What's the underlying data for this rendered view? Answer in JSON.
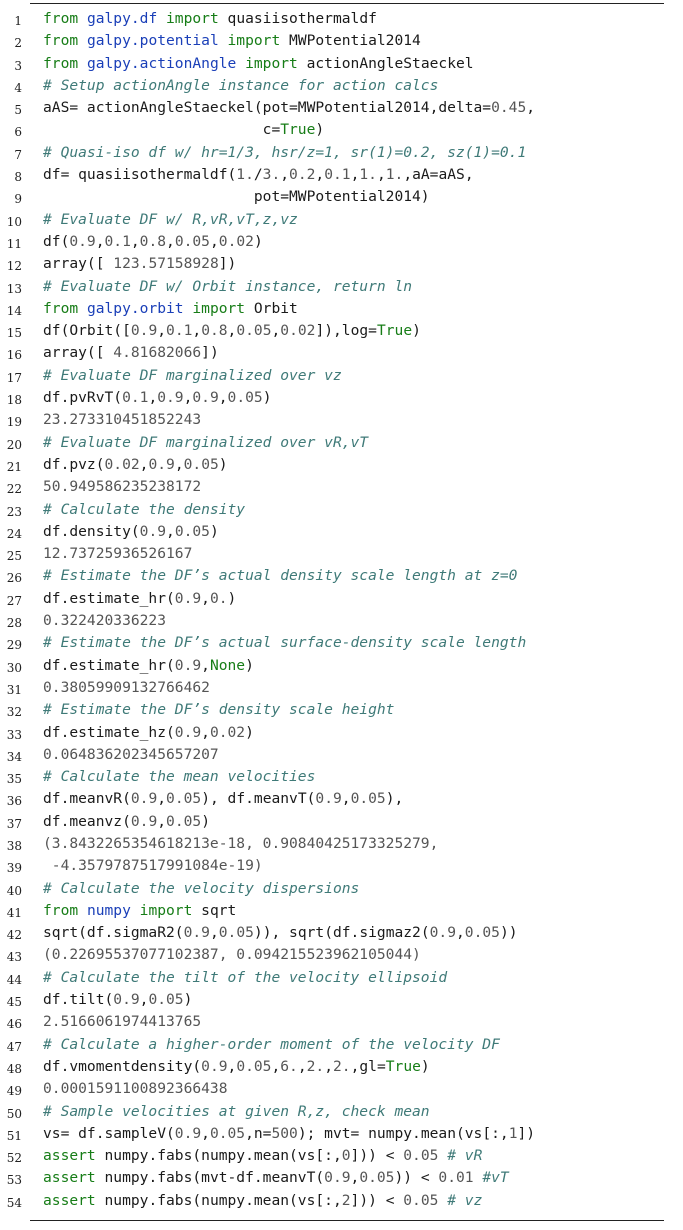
{
  "lines": [
    {
      "n": "1",
      "tokens": [
        {
          "t": "from ",
          "c": "kw"
        },
        {
          "t": "galpy.df",
          "c": "mod"
        },
        {
          "t": " import ",
          "c": "kw"
        },
        {
          "t": "quasiisothermaldf",
          "c": ""
        }
      ]
    },
    {
      "n": "2",
      "tokens": [
        {
          "t": "from ",
          "c": "kw"
        },
        {
          "t": "galpy.potential",
          "c": "mod"
        },
        {
          "t": " import ",
          "c": "kw"
        },
        {
          "t": "MWPotential2014",
          "c": ""
        }
      ]
    },
    {
      "n": "3",
      "tokens": [
        {
          "t": "from ",
          "c": "kw"
        },
        {
          "t": "galpy.actionAngle",
          "c": "mod"
        },
        {
          "t": " import ",
          "c": "kw"
        },
        {
          "t": "actionAngleStaeckel",
          "c": ""
        }
      ]
    },
    {
      "n": "4",
      "tokens": [
        {
          "t": "# Setup actionAngle instance for action calcs",
          "c": "cm"
        }
      ]
    },
    {
      "n": "5",
      "tokens": [
        {
          "t": "aAS= actionAngleStaeckel(pot=MWPotential2014,delta=",
          "c": ""
        },
        {
          "t": "0.45",
          "c": "num"
        },
        {
          "t": ",",
          "c": ""
        }
      ]
    },
    {
      "n": "6",
      "tokens": [
        {
          "t": "                         c=",
          "c": ""
        },
        {
          "t": "True",
          "c": "kw"
        },
        {
          "t": ")",
          "c": ""
        }
      ]
    },
    {
      "n": "7",
      "tokens": [
        {
          "t": "# Quasi-iso df w/ hr=1/3, hsr/z=1, sr(1)=0.2, sz(1)=0.1",
          "c": "cm"
        }
      ]
    },
    {
      "n": "8",
      "tokens": [
        {
          "t": "df= quasiisothermaldf(",
          "c": ""
        },
        {
          "t": "1.",
          "c": "num"
        },
        {
          "t": "/",
          "c": ""
        },
        {
          "t": "3.",
          "c": "num"
        },
        {
          "t": ",",
          "c": ""
        },
        {
          "t": "0.2",
          "c": "num"
        },
        {
          "t": ",",
          "c": ""
        },
        {
          "t": "0.1",
          "c": "num"
        },
        {
          "t": ",",
          "c": ""
        },
        {
          "t": "1.",
          "c": "num"
        },
        {
          "t": ",",
          "c": ""
        },
        {
          "t": "1.",
          "c": "num"
        },
        {
          "t": ",aA=aAS,",
          "c": ""
        }
      ]
    },
    {
      "n": "9",
      "tokens": [
        {
          "t": "                        pot=MWPotential2014)",
          "c": ""
        }
      ]
    },
    {
      "n": "10",
      "tokens": [
        {
          "t": "# Evaluate DF w/ R,vR,vT,z,vz",
          "c": "cm"
        }
      ]
    },
    {
      "n": "11",
      "tokens": [
        {
          "t": "df(",
          "c": ""
        },
        {
          "t": "0.9",
          "c": "num"
        },
        {
          "t": ",",
          "c": ""
        },
        {
          "t": "0.1",
          "c": "num"
        },
        {
          "t": ",",
          "c": ""
        },
        {
          "t": "0.8",
          "c": "num"
        },
        {
          "t": ",",
          "c": ""
        },
        {
          "t": "0.05",
          "c": "num"
        },
        {
          "t": ",",
          "c": ""
        },
        {
          "t": "0.02",
          "c": "num"
        },
        {
          "t": ")",
          "c": ""
        }
      ]
    },
    {
      "n": "12",
      "tokens": [
        {
          "t": "array([ ",
          "c": ""
        },
        {
          "t": "123.57158928",
          "c": "num"
        },
        {
          "t": "])",
          "c": ""
        }
      ]
    },
    {
      "n": "13",
      "tokens": [
        {
          "t": "# Evaluate DF w/ Orbit instance, return ln",
          "c": "cm"
        }
      ]
    },
    {
      "n": "14",
      "tokens": [
        {
          "t": "from ",
          "c": "kw"
        },
        {
          "t": "galpy.orbit",
          "c": "mod"
        },
        {
          "t": " import ",
          "c": "kw"
        },
        {
          "t": "Orbit",
          "c": ""
        }
      ]
    },
    {
      "n": "15",
      "tokens": [
        {
          "t": "df(Orbit([",
          "c": ""
        },
        {
          "t": "0.9",
          "c": "num"
        },
        {
          "t": ",",
          "c": ""
        },
        {
          "t": "0.1",
          "c": "num"
        },
        {
          "t": ",",
          "c": ""
        },
        {
          "t": "0.8",
          "c": "num"
        },
        {
          "t": ",",
          "c": ""
        },
        {
          "t": "0.05",
          "c": "num"
        },
        {
          "t": ",",
          "c": ""
        },
        {
          "t": "0.02",
          "c": "num"
        },
        {
          "t": "]),log=",
          "c": ""
        },
        {
          "t": "True",
          "c": "kw"
        },
        {
          "t": ")",
          "c": ""
        }
      ]
    },
    {
      "n": "16",
      "tokens": [
        {
          "t": "array([ ",
          "c": ""
        },
        {
          "t": "4.81682066",
          "c": "num"
        },
        {
          "t": "])",
          "c": ""
        }
      ]
    },
    {
      "n": "17",
      "tokens": [
        {
          "t": "# Evaluate DF marginalized over vz",
          "c": "cm"
        }
      ]
    },
    {
      "n": "18",
      "tokens": [
        {
          "t": "df.pvRvT(",
          "c": ""
        },
        {
          "t": "0.1",
          "c": "num"
        },
        {
          "t": ",",
          "c": ""
        },
        {
          "t": "0.9",
          "c": "num"
        },
        {
          "t": ",",
          "c": ""
        },
        {
          "t": "0.9",
          "c": "num"
        },
        {
          "t": ",",
          "c": ""
        },
        {
          "t": "0.05",
          "c": "num"
        },
        {
          "t": ")",
          "c": ""
        }
      ]
    },
    {
      "n": "19",
      "tokens": [
        {
          "t": "23.273310451852243",
          "c": "out"
        }
      ]
    },
    {
      "n": "20",
      "tokens": [
        {
          "t": "# Evaluate DF marginalized over vR,vT",
          "c": "cm"
        }
      ]
    },
    {
      "n": "21",
      "tokens": [
        {
          "t": "df.pvz(",
          "c": ""
        },
        {
          "t": "0.02",
          "c": "num"
        },
        {
          "t": ",",
          "c": ""
        },
        {
          "t": "0.9",
          "c": "num"
        },
        {
          "t": ",",
          "c": ""
        },
        {
          "t": "0.05",
          "c": "num"
        },
        {
          "t": ")",
          "c": ""
        }
      ]
    },
    {
      "n": "22",
      "tokens": [
        {
          "t": "50.949586235238172",
          "c": "out"
        }
      ]
    },
    {
      "n": "23",
      "tokens": [
        {
          "t": "# Calculate the density",
          "c": "cm"
        }
      ]
    },
    {
      "n": "24",
      "tokens": [
        {
          "t": "df.density(",
          "c": ""
        },
        {
          "t": "0.9",
          "c": "num"
        },
        {
          "t": ",",
          "c": ""
        },
        {
          "t": "0.05",
          "c": "num"
        },
        {
          "t": ")",
          "c": ""
        }
      ]
    },
    {
      "n": "25",
      "tokens": [
        {
          "t": "12.73725936526167",
          "c": "out"
        }
      ]
    },
    {
      "n": "26",
      "tokens": [
        {
          "t": "# Estimate the DF’s actual density scale length at z=0",
          "c": "cm"
        }
      ]
    },
    {
      "n": "27",
      "tokens": [
        {
          "t": "df.estimate_hr(",
          "c": ""
        },
        {
          "t": "0.9",
          "c": "num"
        },
        {
          "t": ",",
          "c": ""
        },
        {
          "t": "0.",
          "c": "num"
        },
        {
          "t": ")",
          "c": ""
        }
      ]
    },
    {
      "n": "28",
      "tokens": [
        {
          "t": "0.322420336223",
          "c": "out"
        }
      ]
    },
    {
      "n": "29",
      "tokens": [
        {
          "t": "# Estimate the DF’s actual surface-density scale length",
          "c": "cm"
        }
      ]
    },
    {
      "n": "30",
      "tokens": [
        {
          "t": "df.estimate_hr(",
          "c": ""
        },
        {
          "t": "0.9",
          "c": "num"
        },
        {
          "t": ",",
          "c": ""
        },
        {
          "t": "None",
          "c": "kw"
        },
        {
          "t": ")",
          "c": ""
        }
      ]
    },
    {
      "n": "31",
      "tokens": [
        {
          "t": "0.38059909132766462",
          "c": "out"
        }
      ]
    },
    {
      "n": "32",
      "tokens": [
        {
          "t": "# Estimate the DF’s density scale height",
          "c": "cm"
        }
      ]
    },
    {
      "n": "33",
      "tokens": [
        {
          "t": "df.estimate_hz(",
          "c": ""
        },
        {
          "t": "0.9",
          "c": "num"
        },
        {
          "t": ",",
          "c": ""
        },
        {
          "t": "0.02",
          "c": "num"
        },
        {
          "t": ")",
          "c": ""
        }
      ]
    },
    {
      "n": "34",
      "tokens": [
        {
          "t": "0.064836202345657207",
          "c": "out"
        }
      ]
    },
    {
      "n": "35",
      "tokens": [
        {
          "t": "# Calculate the mean velocities",
          "c": "cm"
        }
      ]
    },
    {
      "n": "36",
      "tokens": [
        {
          "t": "df.meanvR(",
          "c": ""
        },
        {
          "t": "0.9",
          "c": "num"
        },
        {
          "t": ",",
          "c": ""
        },
        {
          "t": "0.05",
          "c": "num"
        },
        {
          "t": "), df.meanvT(",
          "c": ""
        },
        {
          "t": "0.9",
          "c": "num"
        },
        {
          "t": ",",
          "c": ""
        },
        {
          "t": "0.05",
          "c": "num"
        },
        {
          "t": "),",
          "c": ""
        }
      ]
    },
    {
      "n": "37",
      "tokens": [
        {
          "t": "df.meanvz(",
          "c": ""
        },
        {
          "t": "0.9",
          "c": "num"
        },
        {
          "t": ",",
          "c": ""
        },
        {
          "t": "0.05",
          "c": "num"
        },
        {
          "t": ")",
          "c": ""
        }
      ]
    },
    {
      "n": "38",
      "tokens": [
        {
          "t": "(3.8432265354618213e-18, 0.90840425173325279,",
          "c": "out"
        }
      ]
    },
    {
      "n": "39",
      "tokens": [
        {
          "t": " -4.3579787517991084e-19)",
          "c": "out"
        }
      ]
    },
    {
      "n": "40",
      "tokens": [
        {
          "t": "# Calculate the velocity dispersions",
          "c": "cm"
        }
      ]
    },
    {
      "n": "41",
      "tokens": [
        {
          "t": "from ",
          "c": "kw"
        },
        {
          "t": "numpy",
          "c": "mod"
        },
        {
          "t": " import ",
          "c": "kw"
        },
        {
          "t": "sqrt",
          "c": ""
        }
      ]
    },
    {
      "n": "42",
      "tokens": [
        {
          "t": "sqrt(df.sigmaR2(",
          "c": ""
        },
        {
          "t": "0.9",
          "c": "num"
        },
        {
          "t": ",",
          "c": ""
        },
        {
          "t": "0.05",
          "c": "num"
        },
        {
          "t": ")), sqrt(df.sigmaz2(",
          "c": ""
        },
        {
          "t": "0.9",
          "c": "num"
        },
        {
          "t": ",",
          "c": ""
        },
        {
          "t": "0.05",
          "c": "num"
        },
        {
          "t": "))",
          "c": ""
        }
      ]
    },
    {
      "n": "43",
      "tokens": [
        {
          "t": "(0.22695537077102387, 0.094215523962105044)",
          "c": "out"
        }
      ]
    },
    {
      "n": "44",
      "tokens": [
        {
          "t": "# Calculate the tilt of the velocity ellipsoid",
          "c": "cm"
        }
      ]
    },
    {
      "n": "45",
      "tokens": [
        {
          "t": "df.tilt(",
          "c": ""
        },
        {
          "t": "0.9",
          "c": "num"
        },
        {
          "t": ",",
          "c": ""
        },
        {
          "t": "0.05",
          "c": "num"
        },
        {
          "t": ")",
          "c": ""
        }
      ]
    },
    {
      "n": "46",
      "tokens": [
        {
          "t": "2.5166061974413765",
          "c": "out"
        }
      ]
    },
    {
      "n": "47",
      "tokens": [
        {
          "t": "# Calculate a higher-order moment of the velocity DF",
          "c": "cm"
        }
      ]
    },
    {
      "n": "48",
      "tokens": [
        {
          "t": "df.vmomentdensity(",
          "c": ""
        },
        {
          "t": "0.9",
          "c": "num"
        },
        {
          "t": ",",
          "c": ""
        },
        {
          "t": "0.05",
          "c": "num"
        },
        {
          "t": ",",
          "c": ""
        },
        {
          "t": "6.",
          "c": "num"
        },
        {
          "t": ",",
          "c": ""
        },
        {
          "t": "2.",
          "c": "num"
        },
        {
          "t": ",",
          "c": ""
        },
        {
          "t": "2.",
          "c": "num"
        },
        {
          "t": ",gl=",
          "c": ""
        },
        {
          "t": "True",
          "c": "kw"
        },
        {
          "t": ")",
          "c": ""
        }
      ]
    },
    {
      "n": "49",
      "tokens": [
        {
          "t": "0.0001591100892366438",
          "c": "out"
        }
      ]
    },
    {
      "n": "50",
      "tokens": [
        {
          "t": "# Sample velocities at given R,z, check mean",
          "c": "cm"
        }
      ]
    },
    {
      "n": "51",
      "tokens": [
        {
          "t": "vs= df.sampleV(",
          "c": ""
        },
        {
          "t": "0.9",
          "c": "num"
        },
        {
          "t": ",",
          "c": ""
        },
        {
          "t": "0.05",
          "c": "num"
        },
        {
          "t": ",n=",
          "c": ""
        },
        {
          "t": "500",
          "c": "num"
        },
        {
          "t": "); mvt= numpy.mean(vs[:,",
          "c": ""
        },
        {
          "t": "1",
          "c": "num"
        },
        {
          "t": "])",
          "c": ""
        }
      ]
    },
    {
      "n": "52",
      "tokens": [
        {
          "t": "assert ",
          "c": "kw"
        },
        {
          "t": "numpy.fabs(numpy.mean(vs[:,",
          "c": ""
        },
        {
          "t": "0",
          "c": "num"
        },
        {
          "t": "])) < ",
          "c": ""
        },
        {
          "t": "0.05",
          "c": "num"
        },
        {
          "t": " # vR",
          "c": "cm"
        }
      ]
    },
    {
      "n": "53",
      "tokens": [
        {
          "t": "assert ",
          "c": "kw"
        },
        {
          "t": "numpy.fabs(mvt-df.meanvT(",
          "c": ""
        },
        {
          "t": "0.9",
          "c": "num"
        },
        {
          "t": ",",
          "c": ""
        },
        {
          "t": "0.05",
          "c": "num"
        },
        {
          "t": ")) < ",
          "c": ""
        },
        {
          "t": "0.01",
          "c": "num"
        },
        {
          "t": " #vT",
          "c": "cm"
        }
      ]
    },
    {
      "n": "54",
      "tokens": [
        {
          "t": "assert ",
          "c": "kw"
        },
        {
          "t": "numpy.fabs(numpy.mean(vs[:,",
          "c": ""
        },
        {
          "t": "2",
          "c": "num"
        },
        {
          "t": "])) < ",
          "c": ""
        },
        {
          "t": "0.05",
          "c": "num"
        },
        {
          "t": " # vz",
          "c": "cm"
        }
      ]
    }
  ]
}
